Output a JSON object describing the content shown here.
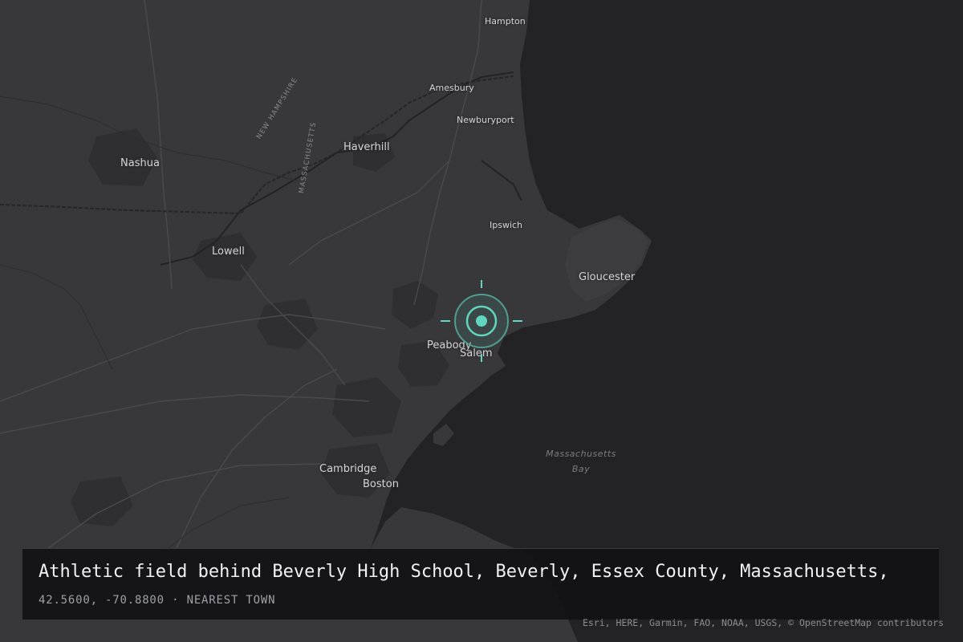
{
  "map": {
    "colors": {
      "land": "#38383b",
      "water": "#232326",
      "roads": "#4a4a4e",
      "accent": "#5fd6bd"
    },
    "places": [
      {
        "id": "hampton",
        "name": "Hampton",
        "size": "small"
      },
      {
        "id": "amesbury",
        "name": "Amesbury",
        "size": "small"
      },
      {
        "id": "newburyport",
        "name": "Newburyport",
        "size": "small"
      },
      {
        "id": "haverhill",
        "name": "Haverhill",
        "size": "large"
      },
      {
        "id": "nashua",
        "name": "Nashua",
        "size": "large"
      },
      {
        "id": "lowell",
        "name": "Lowell",
        "size": "large"
      },
      {
        "id": "ipswich",
        "name": "Ipswich",
        "size": "small"
      },
      {
        "id": "gloucester",
        "name": "Gloucester",
        "size": "large"
      },
      {
        "id": "peabody",
        "name": "Peabody",
        "size": "large"
      },
      {
        "id": "salem",
        "name": "Salem",
        "size": "large"
      },
      {
        "id": "cambridge",
        "name": "Cambridge",
        "size": "large"
      },
      {
        "id": "boston",
        "name": "Boston",
        "size": "large"
      }
    ],
    "state_labels": {
      "new_hampshire": "NEW HAMPSHIRE",
      "massachusetts": "MASSACHUSETTS"
    },
    "water_label": {
      "line1": "Massachusetts",
      "line2": "Bay"
    },
    "marker_icon": "location-target-icon"
  },
  "info": {
    "place_name": "Athletic field behind Beverly High School, Beverly, Essex County, Massachusetts,",
    "coords": "42.5600, -70.8800",
    "separator": "·",
    "nearest_label": "NEAREST TOWN"
  },
  "attribution": "Esri, HERE, Garmin, FAO, NOAA, USGS, © OpenStreetMap contributors"
}
